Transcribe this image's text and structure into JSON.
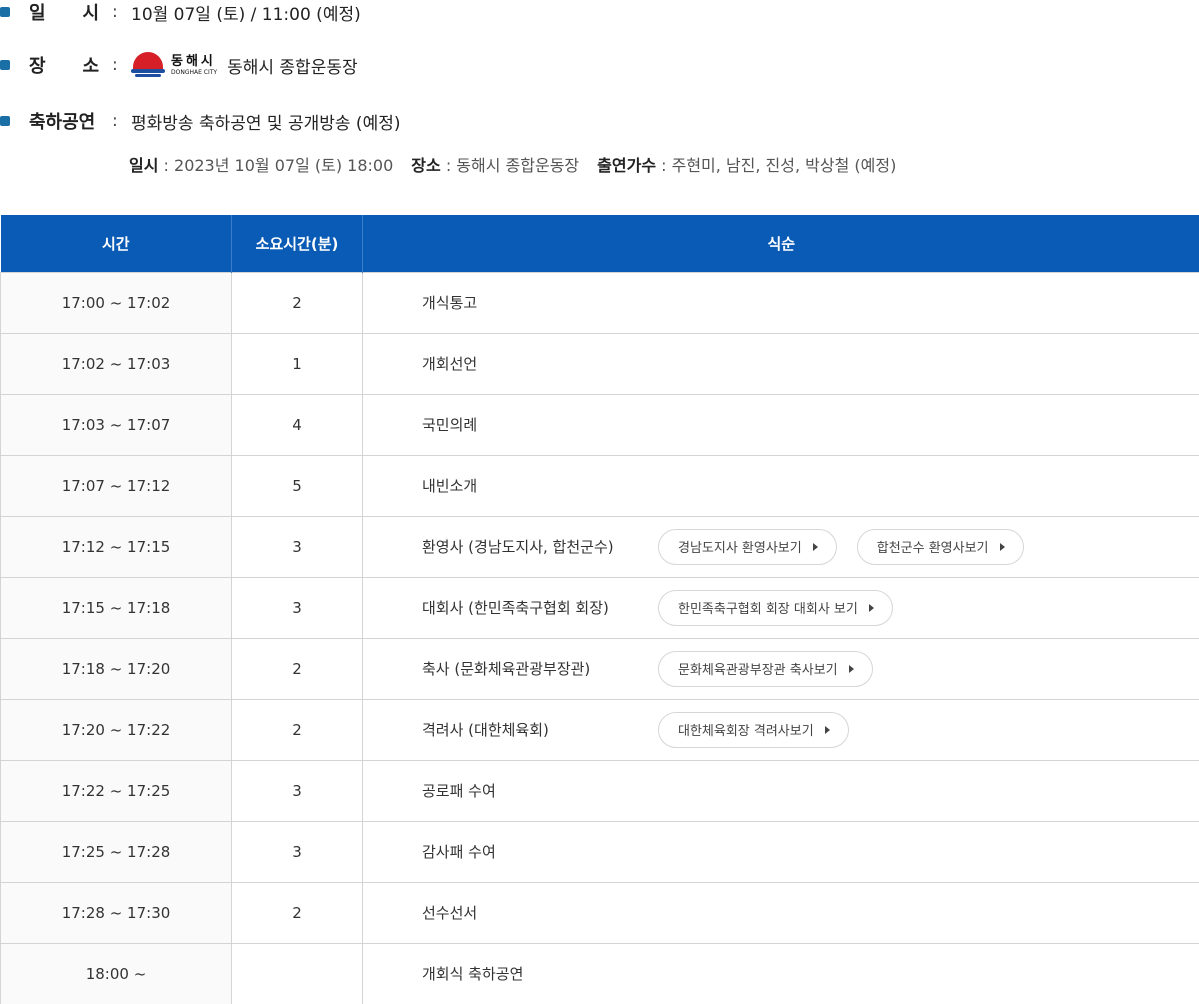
{
  "info": {
    "date": {
      "label_chars": [
        "일",
        "시"
      ],
      "colon": ":",
      "value": "10월 07일 (토) / 11:00 (예정)"
    },
    "place": {
      "label_chars": [
        "장",
        "소"
      ],
      "colon": ":",
      "logo_ko": "동해시",
      "logo_en": "DONGHAE CITY",
      "value": "동해시 종합운동장"
    },
    "show": {
      "label": "축하공연",
      "colon": ":",
      "value": "평화방송 축하공연 및 공개방송 (예정)"
    }
  },
  "sub_info": {
    "time_key": "일시",
    "time_value": " : 2023년 10월 07일 (토) 18:00",
    "place_key": "장소",
    "place_value": " : 동해시 종합운동장",
    "singers_key": "출연가수",
    "singers_value": " : 주현미, 남진, 진성, 박상철 (예정)"
  },
  "table": {
    "headers": [
      "시간",
      "소요시간(분)",
      "식순"
    ],
    "rows": [
      {
        "time": "17:00 ~ 17:02",
        "duration": "2",
        "program": "개식통고",
        "buttons": []
      },
      {
        "time": "17:02 ~ 17:03",
        "duration": "1",
        "program": "개회선언",
        "buttons": []
      },
      {
        "time": "17:03 ~ 17:07",
        "duration": "4",
        "program": "국민의례",
        "buttons": []
      },
      {
        "time": "17:07 ~ 17:12",
        "duration": "5",
        "program": "내빈소개",
        "buttons": []
      },
      {
        "time": "17:12 ~ 17:15",
        "duration": "3",
        "program": "환영사 (경남도지사, 합천군수)",
        "buttons": [
          "경남도지사 환영사보기",
          "합천군수 환영사보기"
        ]
      },
      {
        "time": "17:15 ~ 17:18",
        "duration": "3",
        "program": "대회사 (한민족축구협회 회장)",
        "buttons": [
          "한민족축구협회 회장 대회사 보기"
        ]
      },
      {
        "time": "17:18 ~ 17:20",
        "duration": "2",
        "program": "축사 (문화체육관광부장관)",
        "buttons": [
          "문화체육관광부장관 축사보기"
        ]
      },
      {
        "time": "17:20 ~ 17:22",
        "duration": "2",
        "program": "격려사 (대한체육회)",
        "buttons": [
          "대한체육회장 격려사보기"
        ]
      },
      {
        "time": "17:22 ~ 17:25",
        "duration": "3",
        "program": "공로패 수여",
        "buttons": []
      },
      {
        "time": "17:25 ~ 17:28",
        "duration": "3",
        "program": "감사패 수여",
        "buttons": []
      },
      {
        "time": "17:28 ~ 17:30",
        "duration": "2",
        "program": "선수선서",
        "buttons": []
      },
      {
        "time": "18:00 ~",
        "duration": "",
        "program": "개회식 축하공연",
        "buttons": []
      }
    ]
  },
  "colors": {
    "header_bg": "#0a5bb5",
    "bullet": "#1a6fa6",
    "logo_red": "#d61f26",
    "logo_blue": "#1d4ea0"
  }
}
